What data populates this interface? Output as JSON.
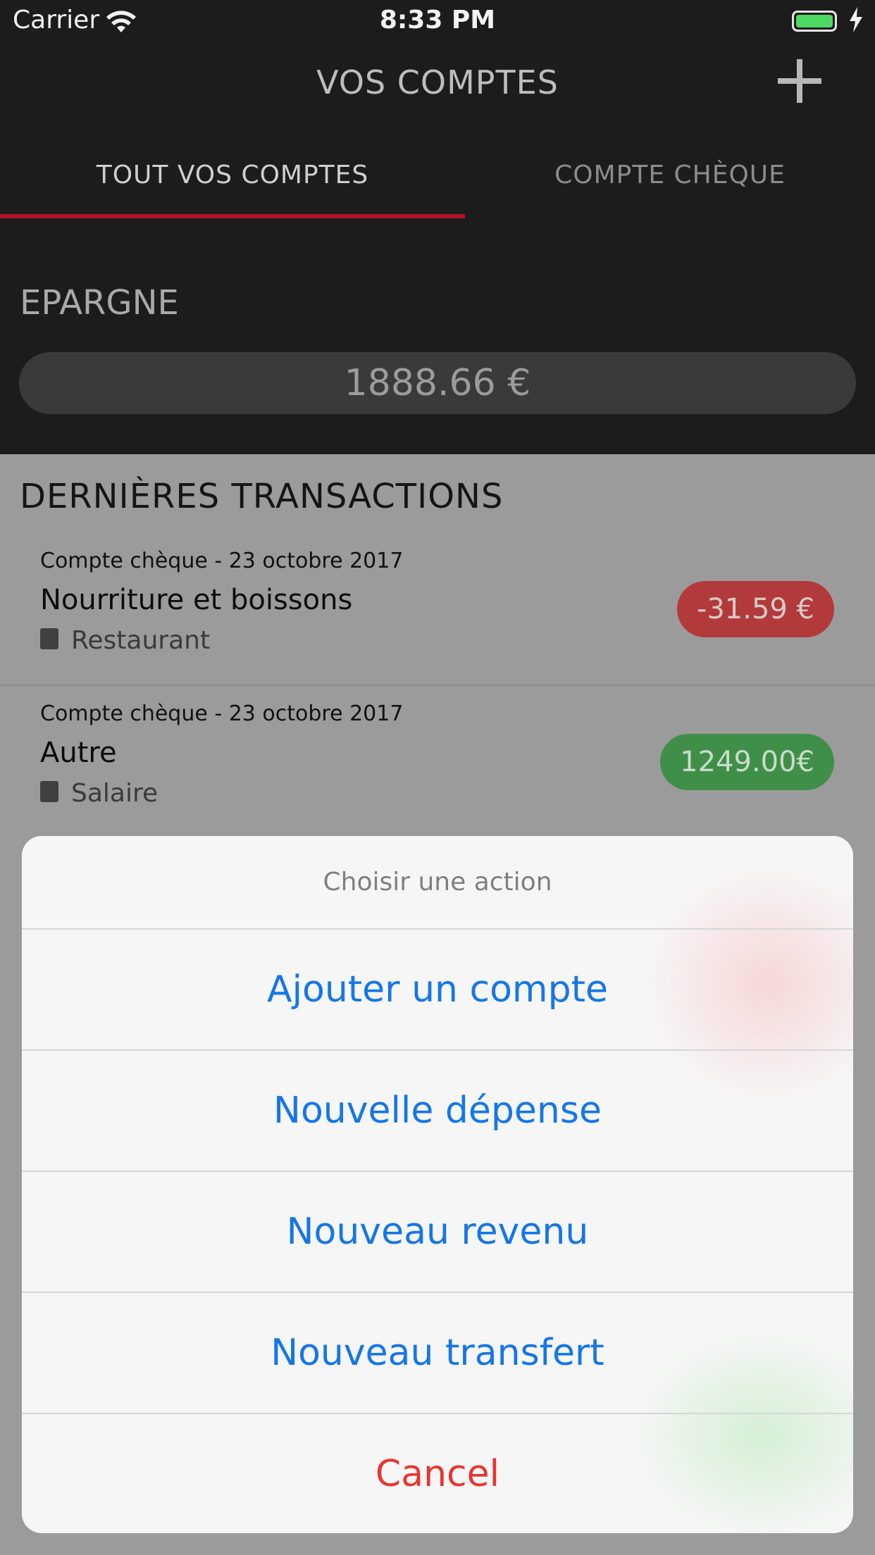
{
  "status_bar": {
    "carrier": "Carrier",
    "time": "8:33 PM"
  },
  "header": {
    "title": "VOS COMPTES"
  },
  "tabs": [
    {
      "label": "TOUT VOS COMPTES"
    },
    {
      "label": "COMPTE CHÈQUE"
    }
  ],
  "savings": {
    "label": "EPARGNE",
    "balance": "1888.66 €"
  },
  "transactions_section": {
    "label": "DERNIÈRES TRANSACTIONS"
  },
  "transactions": [
    {
      "meta": "Compte chèque - 23 octobre 2017",
      "title": "Nourriture et boissons",
      "category": "Restaurant",
      "amount": "-31.59 €"
    },
    {
      "meta": "Compte chèque - 23 octobre 2017",
      "title": "Autre",
      "category": "Salaire",
      "amount": "1249.00€"
    }
  ],
  "action_sheet": {
    "title": "Choisir une action",
    "actions": [
      "Ajouter un compte",
      "Nouvelle dépense",
      "Nouveau revenu",
      "Nouveau transfert"
    ],
    "cancel": "Cancel"
  },
  "colors": {
    "accent_red": "#b0142a",
    "action_blue": "#1576e8",
    "cancel_red": "#e8352e",
    "negative_badge": "#b23a3a",
    "positive_badge": "#3f8f49"
  }
}
